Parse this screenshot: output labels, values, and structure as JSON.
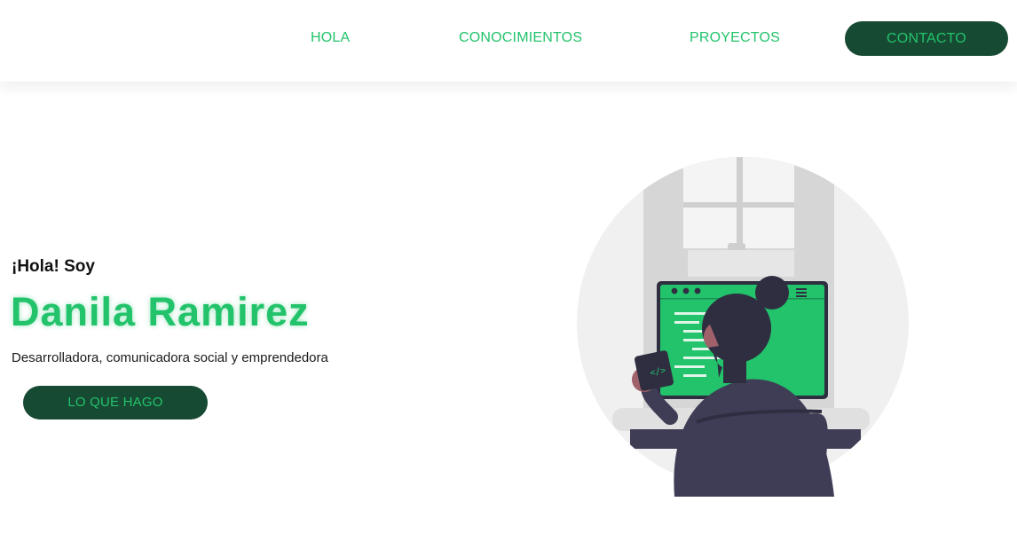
{
  "nav": {
    "links": [
      {
        "label": "HOLA"
      },
      {
        "label": "CONOCIMIENTOS"
      },
      {
        "label": "PROYECTOS"
      }
    ],
    "contact_label": "CONTACTO"
  },
  "hero": {
    "greeting": "¡Hola! Soy",
    "name": "Danila Ramirez",
    "description": "Desarrolladora, comunicadora social y emprendedora",
    "cta_label": "LO QUE HAGO"
  },
  "illustration": {
    "icon": "developer-at-computer-illustration",
    "code_snippet": "</>"
  },
  "colors": {
    "accent": "#22c36b",
    "dark_green": "#174a33",
    "background": "#ffffff"
  }
}
